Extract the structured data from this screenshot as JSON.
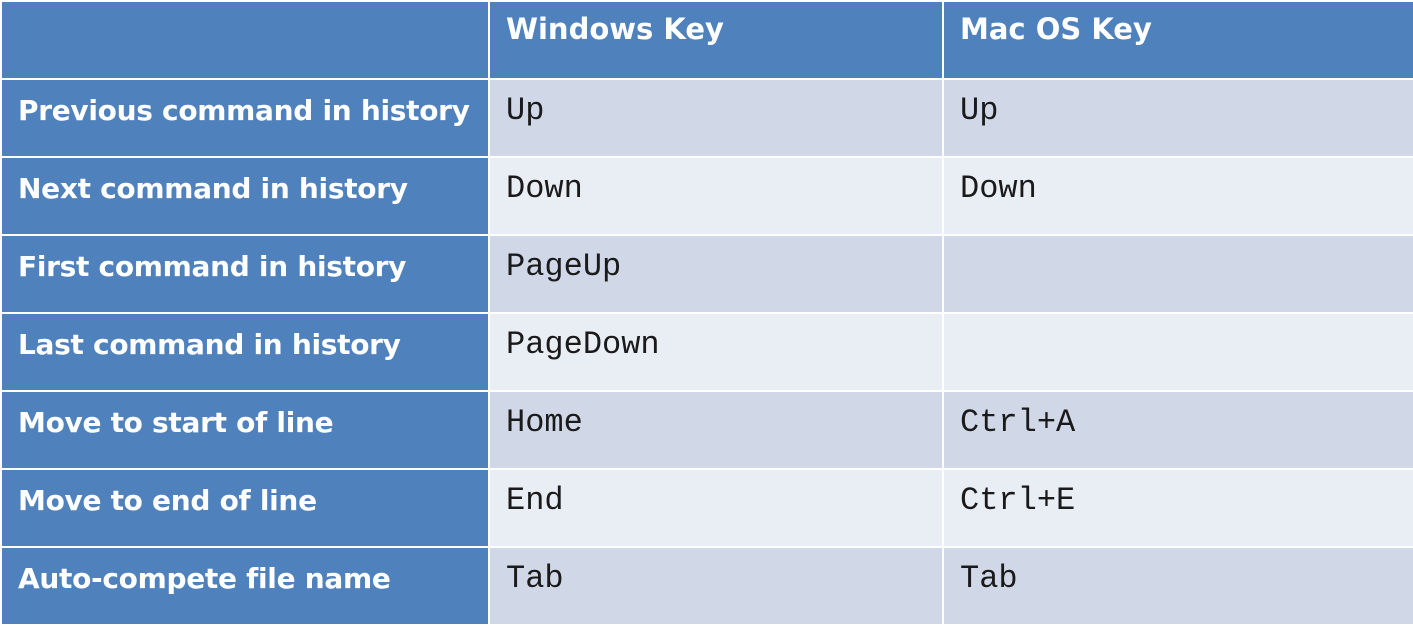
{
  "table": {
    "headers": {
      "action": "",
      "windows": "Windows Key",
      "mac": "Mac OS Key"
    },
    "rows": [
      {
        "action": "Previous command in history",
        "windows": "Up",
        "mac": "Up"
      },
      {
        "action": "Next command in history",
        "windows": "Down",
        "mac": "Down"
      },
      {
        "action": "First command in history",
        "windows": "PageUp",
        "mac": ""
      },
      {
        "action": "Last command in history",
        "windows": "PageDown",
        "mac": ""
      },
      {
        "action": "Move to start of line",
        "windows": "Home",
        "mac": "Ctrl+A"
      },
      {
        "action": "Move to end of line",
        "windows": "End",
        "mac": "Ctrl+E"
      },
      {
        "action": "Auto-compete file name",
        "windows": "Tab",
        "mac": "Tab"
      }
    ]
  },
  "colors": {
    "header_bg": "#4f81bd",
    "row_odd_bg": "#d0d8e8",
    "row_even_bg": "#e9edf4"
  }
}
